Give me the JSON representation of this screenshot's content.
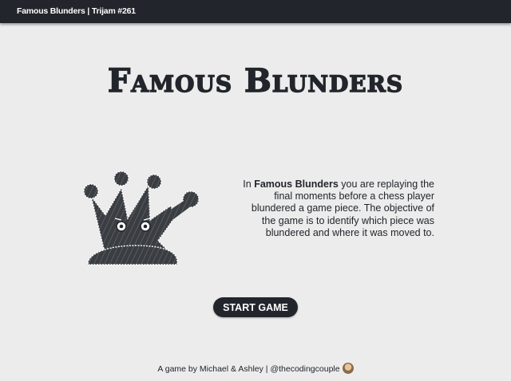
{
  "topbar": {
    "title": "Famous Blunders | Trijam #261"
  },
  "title": "Famous Blunders",
  "mascot": {
    "icon": "queen-chess-piece-icon"
  },
  "description": {
    "intro": "In ",
    "game_name": "Famous Blunders",
    "rest": " you are replaying the final moments before a chess player blundered a game piece. The objective of the game is to identify which piece was blundered and where it was moved to."
  },
  "start_button": {
    "label": "START GAME"
  },
  "footer": {
    "credit": "A game by Michael & Ashley | ",
    "handle": "@thecodingcouple"
  },
  "colors": {
    "dark": "#22252b",
    "background": "#ececec"
  }
}
